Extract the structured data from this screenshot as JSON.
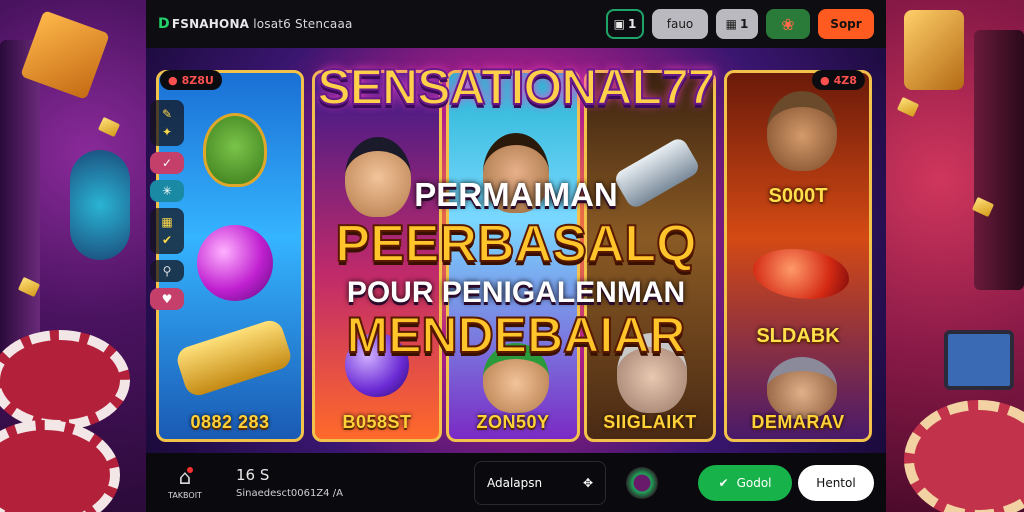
{
  "topbar": {
    "brand_mark": "D",
    "brand_name": "FSNAHONA",
    "brand_sub": "losat6 Stencaaa",
    "cart_count": "1",
    "btn_gray": "fauo",
    "btn_gray_icon_count": "1",
    "btn_orange": "Sopr"
  },
  "logo": "SENSATIONAL77",
  "headline": {
    "line1": "PERMAIMAN",
    "line2": "PEERBASALQ",
    "line3": "POUR PENIGALENMAN",
    "line4": "MENDEBAIAR"
  },
  "reels": {
    "corner_left": "8Z8U",
    "corner_right": "4Z8",
    "r1_label": "0882 283",
    "r2_label": "B058ST",
    "r3_label": "ZON50Y",
    "r4_label": "SIIGLAIKT",
    "r5_top": "S000T",
    "r5_mid": "SLDABK",
    "r5_label": "DEMARAV"
  },
  "bottombar": {
    "home_label": "TAKBOIT",
    "balance": "16 S",
    "account": "Sinaedesct0061Z4 /A",
    "select_value": "Adalapsn",
    "btn_green": "Godol",
    "btn_white": "Hentol"
  },
  "colors": {
    "accent_orange": "#ff5a1f",
    "accent_green": "#18b24a",
    "gold": "#ffc52a"
  }
}
